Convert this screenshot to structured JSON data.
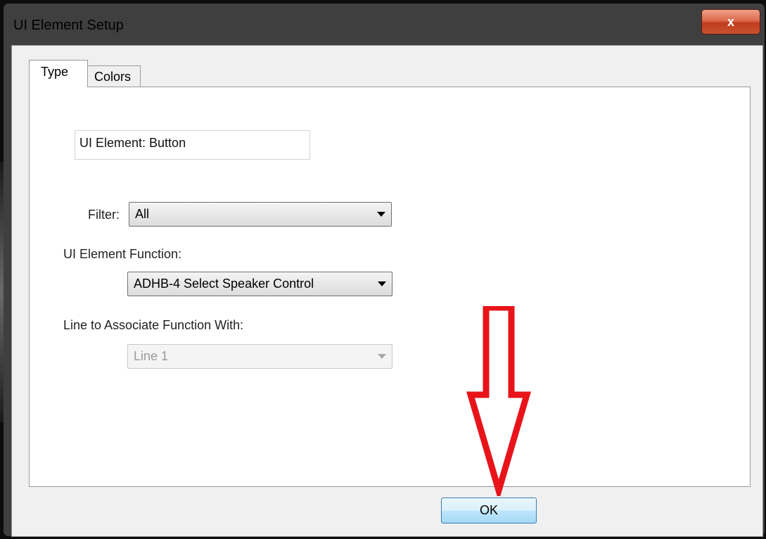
{
  "window": {
    "title": "UI Element Setup",
    "close_glyph": "x"
  },
  "tabs": [
    {
      "label": "Type",
      "active": true
    },
    {
      "label": "Colors",
      "active": false
    }
  ],
  "form": {
    "element_type": "UI Element: Button",
    "filter_label": "Filter:",
    "filter_value": "All",
    "function_label": "UI Element Function:",
    "function_value": "ADHB-4 Select Speaker Control",
    "line_label": "Line to Associate Function With:",
    "line_value": "Line 1"
  },
  "footer": {
    "ok_label": "OK"
  },
  "colors": {
    "annotation_arrow": "#e8141a",
    "ok_border": "#3c7fb1",
    "close_button": "#c23c1f"
  },
  "icons": [
    "close-icon",
    "dropdown-arrow-icon",
    "annotation-arrow-icon"
  ]
}
